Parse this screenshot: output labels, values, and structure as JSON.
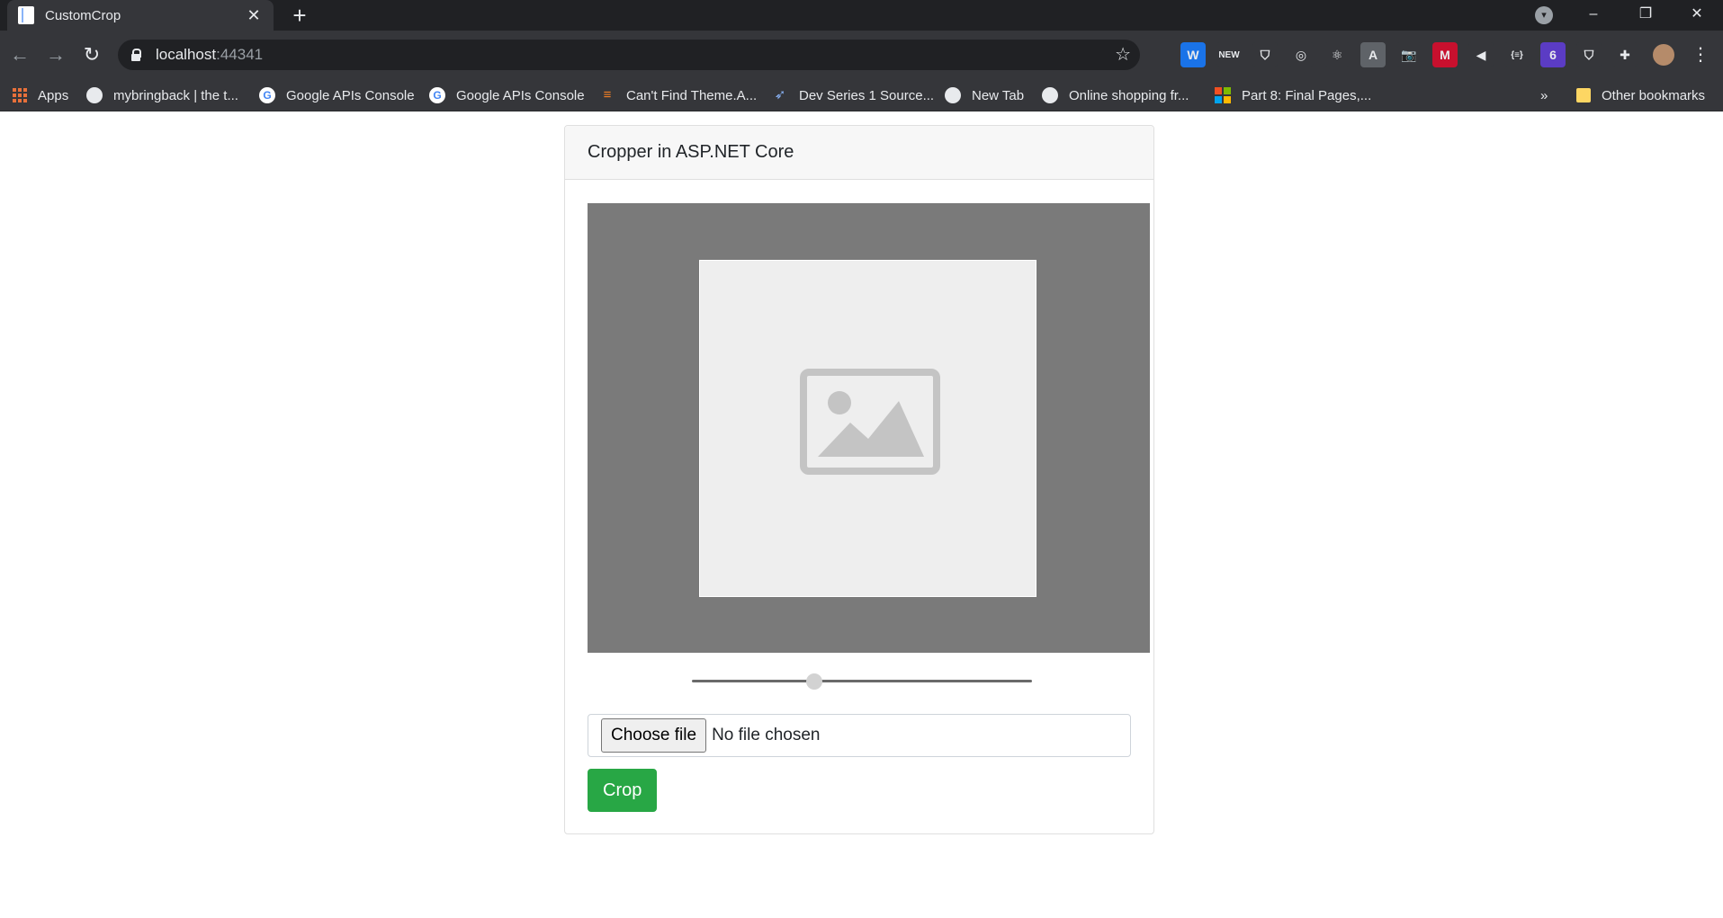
{
  "browser": {
    "tab_title": "CustomCrop",
    "tab_close_glyph": "✕",
    "new_tab_glyph": "+",
    "url_host": "localhost",
    "url_port": ":44341",
    "window_controls": [
      "–",
      "❐",
      "✕"
    ],
    "extensions": [
      {
        "icon": "wappalyzer-icon",
        "label": "W",
        "color": "#1a73e8"
      },
      {
        "icon": "new-badge-icon",
        "label": "NEW",
        "color": "#35363a"
      },
      {
        "icon": "shield-icon",
        "label": "⛉",
        "color": "#35363a"
      },
      {
        "icon": "target-icon",
        "label": "◎",
        "color": "#35363a"
      },
      {
        "icon": "react-icon",
        "label": "⚛",
        "color": "#35363a"
      },
      {
        "icon": "font-icon",
        "label": "A",
        "color": "#5f6368"
      },
      {
        "icon": "camera-icon",
        "label": "📷",
        "color": "#35363a"
      },
      {
        "icon": "mcafee-icon",
        "label": "M",
        "color": "#c8102e"
      },
      {
        "icon": "speaker-icon",
        "label": "◀",
        "color": "#35363a"
      },
      {
        "icon": "json-icon",
        "label": "{≡}",
        "color": "#35363a"
      },
      {
        "icon": "stack-badge-icon",
        "label": "6",
        "color": "#5b3cc4"
      },
      {
        "icon": "pocket-icon",
        "label": "⛉",
        "color": "#35363a"
      },
      {
        "icon": "puzzle-icon",
        "label": "✚",
        "color": "#35363a"
      }
    ],
    "bookmarks_overflow": "»",
    "bookmarks": [
      {
        "label": "Apps",
        "icon": "apps-grid-icon"
      },
      {
        "label": "mybringback | the t...",
        "icon": "globe-icon"
      },
      {
        "label": "Google APIs Console",
        "icon": "google-icon"
      },
      {
        "label": "Google APIs Console",
        "icon": "google-icon"
      },
      {
        "label": "Can't Find Theme.A...",
        "icon": "stackoverflow-icon"
      },
      {
        "label": "Dev Series 1 Source...",
        "icon": "rocket-icon"
      },
      {
        "label": "New Tab",
        "icon": "globe-icon"
      },
      {
        "label": "Online shopping fr...",
        "icon": "globe-icon"
      },
      {
        "label": "Part 8: Final Pages,...",
        "icon": "microsoft-icon"
      },
      {
        "label": "Other bookmarks",
        "icon": "folder-icon"
      }
    ]
  },
  "page": {
    "card_title": "Cropper in ASP.NET Core",
    "zoom_slider_value": 0.36,
    "file_input": {
      "button_label": "Choose file",
      "status_text": "No file chosen"
    },
    "crop_button_label": "Crop"
  },
  "colors": {
    "crop_button": "#28a745",
    "crop_area_bg": "#7a7a7a",
    "image_placeholder_bg": "#eeeeee"
  }
}
